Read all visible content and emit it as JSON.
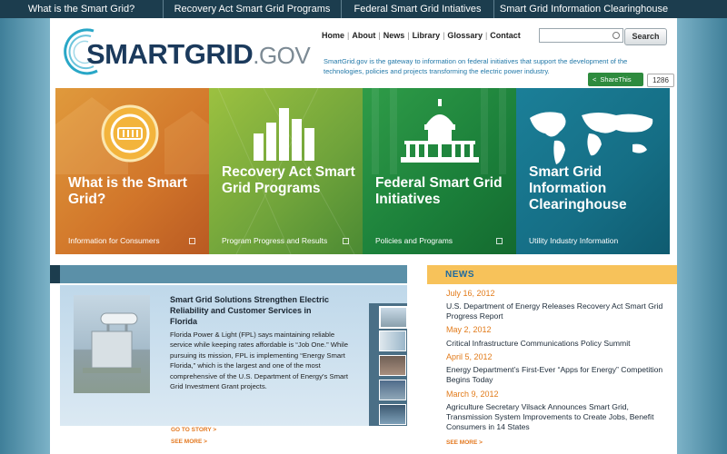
{
  "top_nav": [
    {
      "label": "What is the Smart Grid?"
    },
    {
      "label": "Recovery Act Smart Grid Programs"
    },
    {
      "label": "Federal Smart Grid Intiatives"
    },
    {
      "label": "Smart Grid Information Clearinghouse"
    }
  ],
  "logo": {
    "main": "SMARTGRID",
    "suffix": ".GOV"
  },
  "utility_nav": [
    "Home",
    "About",
    "News",
    "Library",
    "Glossary",
    "Contact"
  ],
  "search": {
    "placeholder": "",
    "button_label": "Search"
  },
  "tagline": "SmartGrid.gov is the gateway to information on federal initiatives that support the development of the technologies, policies and projects transforming the electric power industry.",
  "share": {
    "label": "ShareThis",
    "count": "1286"
  },
  "tiles": [
    {
      "title": "What is the Smart Grid?",
      "subtitle": "Information for Consumers",
      "color": "#d1752a"
    },
    {
      "title": "Recovery Act Smart Grid Programs",
      "subtitle": "Program Progress and Results",
      "color": "#6fa33b"
    },
    {
      "title": "Federal Smart Grid Initiatives",
      "subtitle": "Policies and Programs",
      "color": "#1b7f3a"
    },
    {
      "title": "Smart Grid Information Clearinghouse",
      "subtitle": "Utility Industry Information",
      "color": "#156e85"
    }
  ],
  "feature": {
    "title": "Smart Grid Solutions Strengthen Electric Reliability and Customer Services in Florida",
    "body": "Florida Power & Light (FPL) says maintaining reliable service while keeping rates affordable is “Job One.” While pursuing its mission, FPL is implementing “Energy Smart Florida,” which is the largest and one of the most comprehensive of the U.S. Department of Energy’s Smart Grid Investment Grant projects.",
    "go_to_story": "GO TO STORY >",
    "see_more": "SEE MORE >"
  },
  "news": {
    "label": "NEWS",
    "items": [
      {
        "date": "July 16, 2012",
        "headline": "U.S. Department of Energy Releases Recovery Act Smart Grid Progress Report"
      },
      {
        "date": "May 2, 2012",
        "headline": "Critical Infrastructure Communications Policy Summit"
      },
      {
        "date": "April 5, 2012",
        "headline": "Energy Department’s First-Ever “Apps for Energy” Competition Begins Today"
      },
      {
        "date": "March 9, 2012",
        "headline": "Agriculture Secretary Vilsack Announces Smart Grid, Transmission System Improvements to Create Jobs, Benefit Consumers in 14 States"
      }
    ],
    "see_more": "SEE MORE >"
  },
  "colors": {
    "nav_bg": "#1c3d4e",
    "accent_orange": "#e27b1a",
    "link_blue": "#2278a8",
    "news_header": "#f7c25a"
  }
}
